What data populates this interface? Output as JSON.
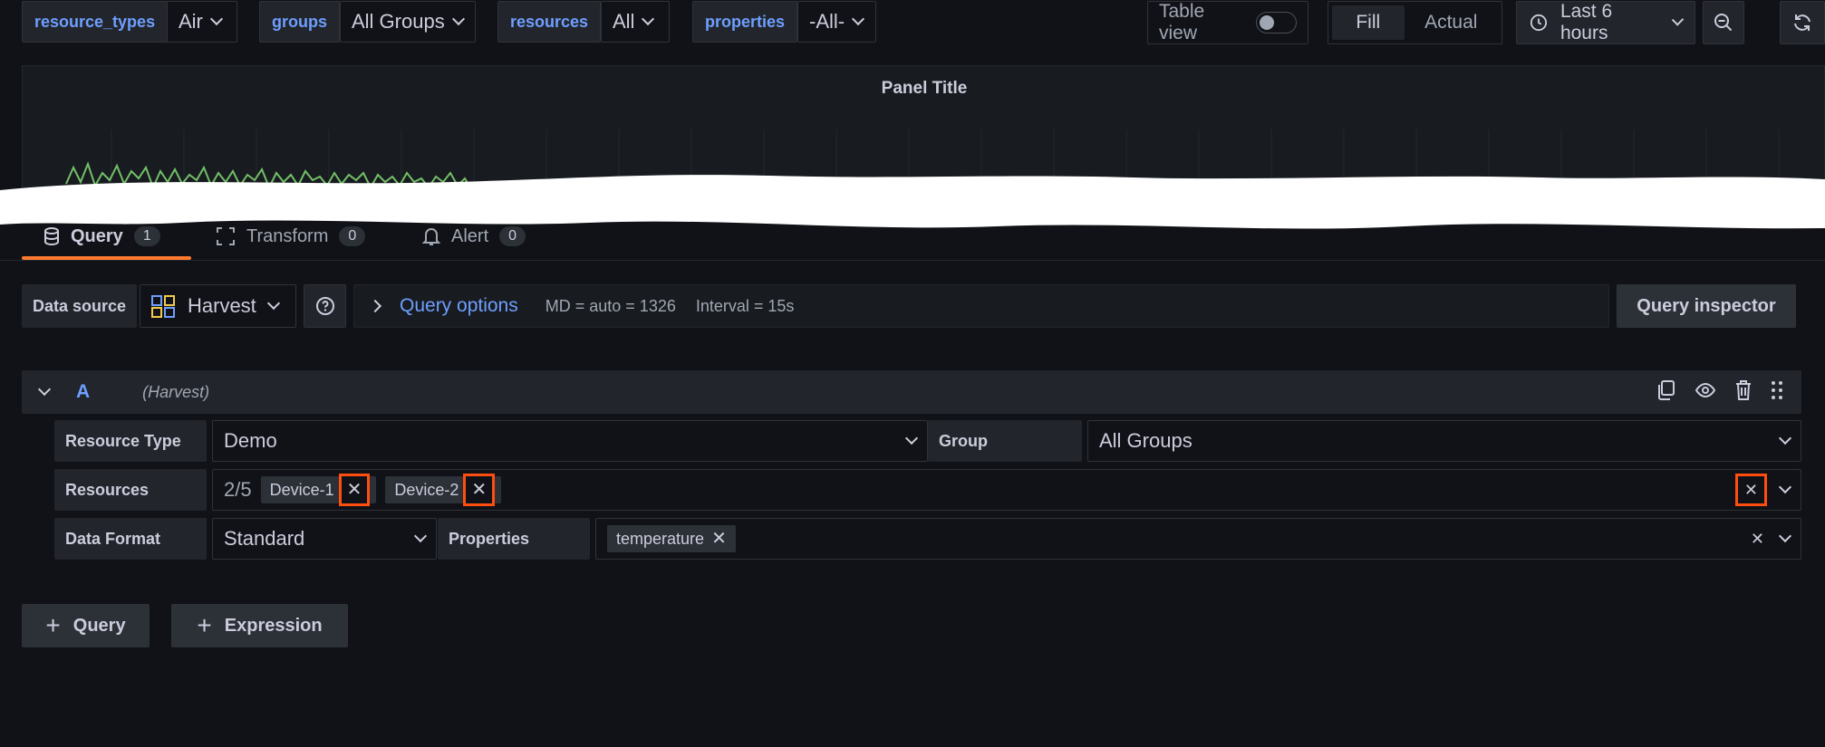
{
  "variables": [
    {
      "label": "resource_types",
      "value": "Air"
    },
    {
      "label": "groups",
      "value": "All Groups"
    },
    {
      "label": "resources",
      "value": "All"
    },
    {
      "label": "properties",
      "value": "-All-"
    }
  ],
  "toolbar": {
    "table_view_label": "Table view",
    "fill_label": "Fill",
    "actual_label": "Actual",
    "time_range": "Last 6 hours"
  },
  "panel": {
    "title": "Panel Title"
  },
  "tabs": [
    {
      "label": "Query",
      "count": "1"
    },
    {
      "label": "Transform",
      "count": "0"
    },
    {
      "label": "Alert",
      "count": "0"
    }
  ],
  "datasource": {
    "label": "Data source",
    "value": "Harvest",
    "query_options_label": "Query options",
    "md_info": "MD = auto = 1326",
    "interval_info": "Interval = 15s",
    "inspector_label": "Query inspector"
  },
  "query": {
    "ref_id": "A",
    "ds_hint": "(Harvest)",
    "resource_type_label": "Resource Type",
    "resource_type_value": "Demo",
    "group_label": "Group",
    "group_value": "All Groups",
    "resources_label": "Resources",
    "resources_count": "2/5",
    "resources_tags": [
      "Device-1",
      "Device-2"
    ],
    "data_format_label": "Data Format",
    "data_format_value": "Standard",
    "properties_label": "Properties",
    "properties_tags": [
      "temperature"
    ]
  },
  "actions": {
    "add_query": "Query",
    "add_expression": "Expression"
  },
  "colors": {
    "accent": "#6e9fff",
    "highlight": "#ff4e0f",
    "series": "#73bf69",
    "tab_underline": "#ff7a2f"
  }
}
